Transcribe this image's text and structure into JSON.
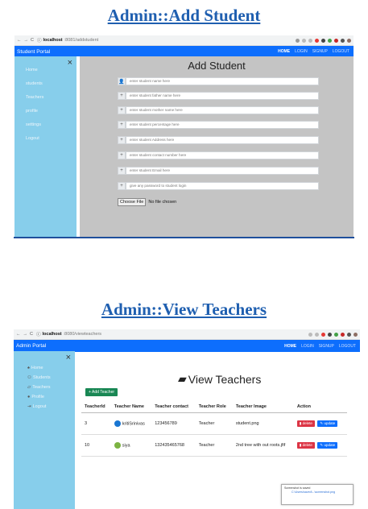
{
  "section1": {
    "heading": "Admin::Add Student",
    "browser": {
      "host": "localhost",
      "path": ":8081/addstudent"
    },
    "navbar": {
      "brand": "Student Portal",
      "links": [
        "HOME",
        "LOGIN",
        "SIGNUP",
        "LOGOUT"
      ]
    },
    "sidebar": {
      "close": "×",
      "items": [
        "Home",
        "students",
        "Teachers",
        "profile",
        "settings",
        "Logout"
      ]
    },
    "form": {
      "title": "Add Student",
      "fields": [
        {
          "icon": "user-icon",
          "symbol": "👤",
          "placeholder": "enter student name here"
        },
        {
          "icon": "plus-icon",
          "symbol": "+",
          "placeholder": "enter student father name here"
        },
        {
          "icon": "plus-icon",
          "symbol": "+",
          "placeholder": "enter student mother name here"
        },
        {
          "icon": "plus-icon",
          "symbol": "+",
          "placeholder": "enter student percentage here"
        },
        {
          "icon": "plus-icon",
          "symbol": "+",
          "placeholder": "enter student Address here"
        },
        {
          "icon": "plus-icon",
          "symbol": "+",
          "placeholder": "enter student contact number here"
        },
        {
          "icon": "plus-icon",
          "symbol": "+",
          "placeholder": "enter student Email here"
        },
        {
          "icon": "plus-icon",
          "symbol": "+",
          "placeholder": "give any password to student login"
        }
      ],
      "file_button": "Choose File",
      "file_status": "No file chosen"
    }
  },
  "section2": {
    "heading": "Admin::View Teachers",
    "browser": {
      "host": "localhost",
      "path": ":8080/viewteachers"
    },
    "navbar": {
      "brand": "Admin Portal",
      "links": [
        "HOME",
        "LOGIN",
        "SIGNUP",
        "LOGOUT"
      ]
    },
    "sidebar": {
      "close": "×",
      "items": [
        "Home",
        "Students",
        "Teachers",
        "Profile",
        "Logout"
      ]
    },
    "title": "View Teachers",
    "add_button": "Add Teacher",
    "table": {
      "headers": [
        "TeacherId",
        "Teacher Name",
        "Teacher contact",
        "Teacher Role",
        "Teacher Image",
        "Action"
      ],
      "rows": [
        {
          "id": "3",
          "name": "kritiSrinivas",
          "contact": "123456789",
          "role": "Teacher",
          "image": "student.png"
        },
        {
          "id": "10",
          "name": "siya",
          "contact": "132435465768",
          "role": "Teacher",
          "image": "2nd tree with out roots.jfif"
        }
      ],
      "delete_label": "delete",
      "update_label": "update"
    },
    "toast": {
      "title": "Screenshot is saved",
      "detail": "C:\\Users\\saved\\...\\screenshot.png"
    }
  },
  "colors": {
    "navbar": "#0d6efd",
    "sidebar": "#87ceeb",
    "heading": "#1f5fb0",
    "add": "#198754",
    "delete": "#dc3545",
    "update": "#0d6efd"
  }
}
